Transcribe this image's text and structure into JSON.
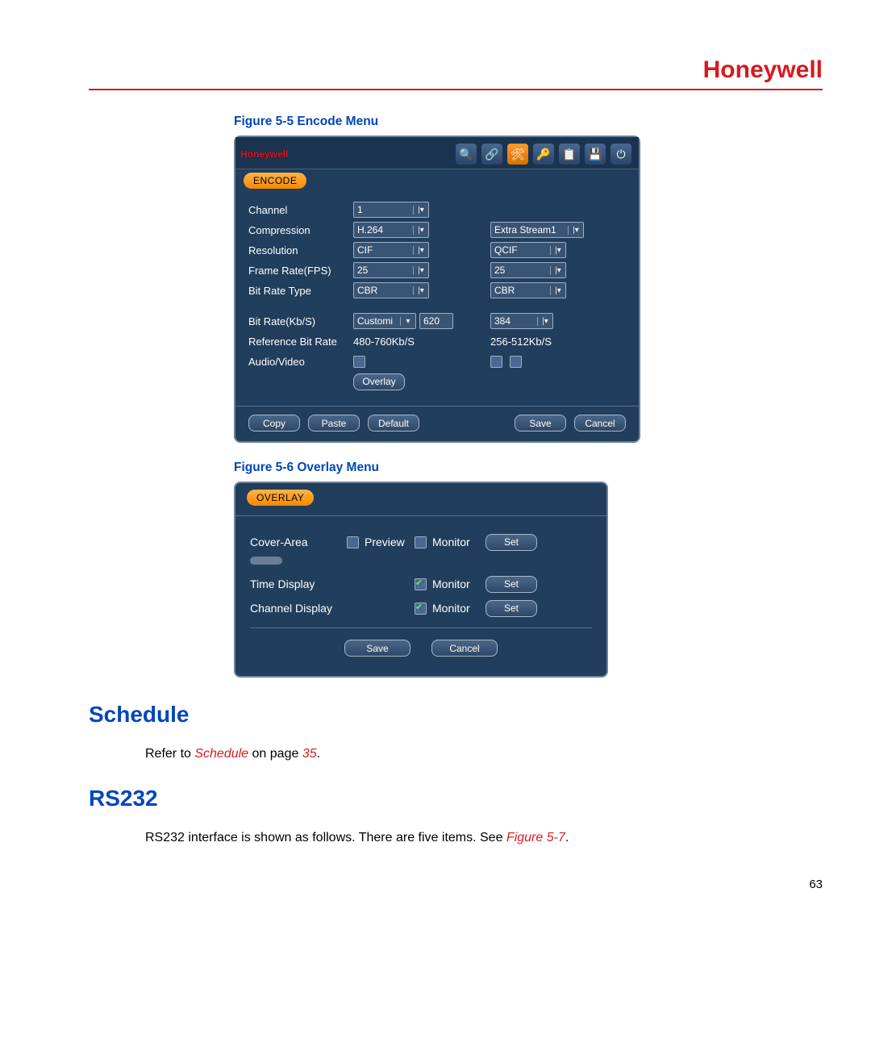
{
  "brand": "Honeywell",
  "figure1_caption": "Figure 5-5 Encode Menu",
  "figure2_caption": "Figure 5-6 Overlay Menu",
  "encode": {
    "logo": "Honeywell",
    "tab": "ENCODE",
    "labels": {
      "channel": "Channel",
      "compression": "Compression",
      "resolution": "Resolution",
      "fps": "Frame Rate(FPS)",
      "brtype": "Bit Rate Type",
      "brkbs": "Bit Rate(Kb/S)",
      "refbr": "Reference Bit Rate",
      "av": "Audio/Video"
    },
    "main": {
      "channel": "1",
      "compression": "H.264",
      "resolution": "CIF",
      "fps": "25",
      "brtype": "CBR",
      "brkbs_mode": "Customi",
      "brkbs_val": "620",
      "refbr": "480-760Kb/S"
    },
    "extra": {
      "stream": "Extra Stream1",
      "resolution": "QCIF",
      "fps": "25",
      "brtype": "CBR",
      "brkbs": "384",
      "refbr": "256-512Kb/S"
    },
    "overlay_btn": "Overlay",
    "buttons": {
      "copy": "Copy",
      "paste": "Paste",
      "default": "Default",
      "save": "Save",
      "cancel": "Cancel"
    }
  },
  "overlay": {
    "tab": "OVERLAY",
    "labels": {
      "cover": "Cover-Area",
      "time": "Time Display",
      "channel": "Channel Display"
    },
    "words": {
      "preview": "Preview",
      "monitor": "Monitor",
      "set": "Set"
    },
    "buttons": {
      "save": "Save",
      "cancel": "Cancel"
    }
  },
  "section_schedule": {
    "heading": "Schedule",
    "text_pre": "Refer to ",
    "text_ref": "Schedule",
    "text_mid": " on page ",
    "text_page": "35",
    "text_post": "."
  },
  "section_rs232": {
    "heading": "RS232",
    "text_pre": "RS232 interface is shown as follows. There are five items. See ",
    "text_ref": "Figure 5-7",
    "text_post": "."
  },
  "page_number": "63"
}
